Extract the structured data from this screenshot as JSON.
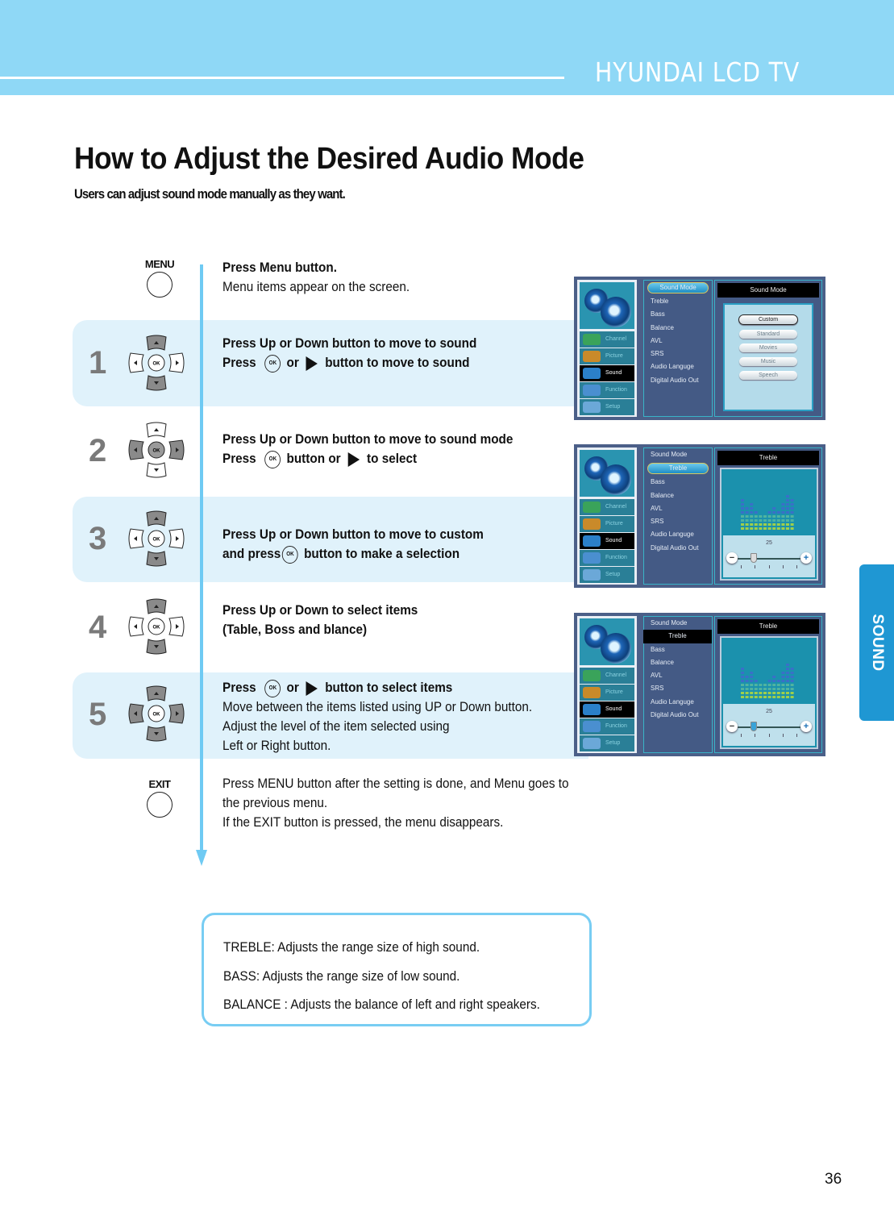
{
  "header": {
    "brand": "HYUNDAI LCD TV"
  },
  "title": "How to Adjust the Desired Audio Mode",
  "subtitle": "Users can adjust sound mode manually as they want.",
  "side_tab": "SOUND",
  "buttons": {
    "menu": "MENU",
    "exit": "EXIT",
    "ok": "OK"
  },
  "menu_step": {
    "line1": "Press Menu button.",
    "line2": "Menu items appear on the screen."
  },
  "steps": [
    {
      "number": "1",
      "line1": "Press Up or Down button to move to sound",
      "line2_a": "Press",
      "line2_b": "or",
      "line2_c": "button to move to sound"
    },
    {
      "number": "2",
      "line1": "Press Up or Down button to move to sound mode",
      "line2_a": "Press",
      "line2_b": "button or",
      "line2_c": "to select"
    },
    {
      "number": "3",
      "line1": "Press Up or Down button to move to custom",
      "line2_a": "and press",
      "line2_b": "button to make a selection"
    },
    {
      "number": "4",
      "line1": "Press Up or Down to select items",
      "line2": "(Table, Boss and blance)"
    },
    {
      "number": "5",
      "line1_a": "Press",
      "line1_b": "or",
      "line1_c": "button to select items",
      "line2": "Move between the items listed using UP or Down button.",
      "line3": "Adjust the level of the item selected using",
      "line4": "Left or Right button."
    }
  ],
  "exit_step": {
    "line1": "Press MENU button after the setting is done, and Menu goes to",
    "line2": "the previous menu.",
    "line3": "If the EXIT button is pressed, the menu disappears."
  },
  "tv_menu": {
    "nav": [
      "Channel",
      "Picture",
      "Sound",
      "Function",
      "Setup"
    ],
    "nav_selected": "Sound",
    "items": [
      "Sound Mode",
      "Treble",
      "Bass",
      "Balance",
      "AVL",
      "SRS",
      "Audio Languge",
      "Digital Audio Out"
    ],
    "screens": [
      {
        "panel_title": "Sound Mode",
        "selected_item": "Sound Mode",
        "options": [
          "Custom",
          "Standard",
          "Movies",
          "Music",
          "Speech"
        ],
        "selected_option": "Custom"
      },
      {
        "panel_title": "Treble",
        "selected_item": "Treble",
        "slider_value": "25"
      },
      {
        "panel_title": "Treble",
        "selected_item": "Treble",
        "slider_value": "25"
      }
    ]
  },
  "note": {
    "treble": "TREBLE: Adjusts the range size of high sound.",
    "bass": "BASS: Adjusts the range size of low sound.",
    "balance": "BALANCE : Adjusts the balance of left and right speakers."
  },
  "page_number": "36",
  "colors": {
    "header": "#8fd8f6",
    "accent": "#6fcaf3",
    "tab": "#1f97d3",
    "band": "#e0f2fb"
  }
}
